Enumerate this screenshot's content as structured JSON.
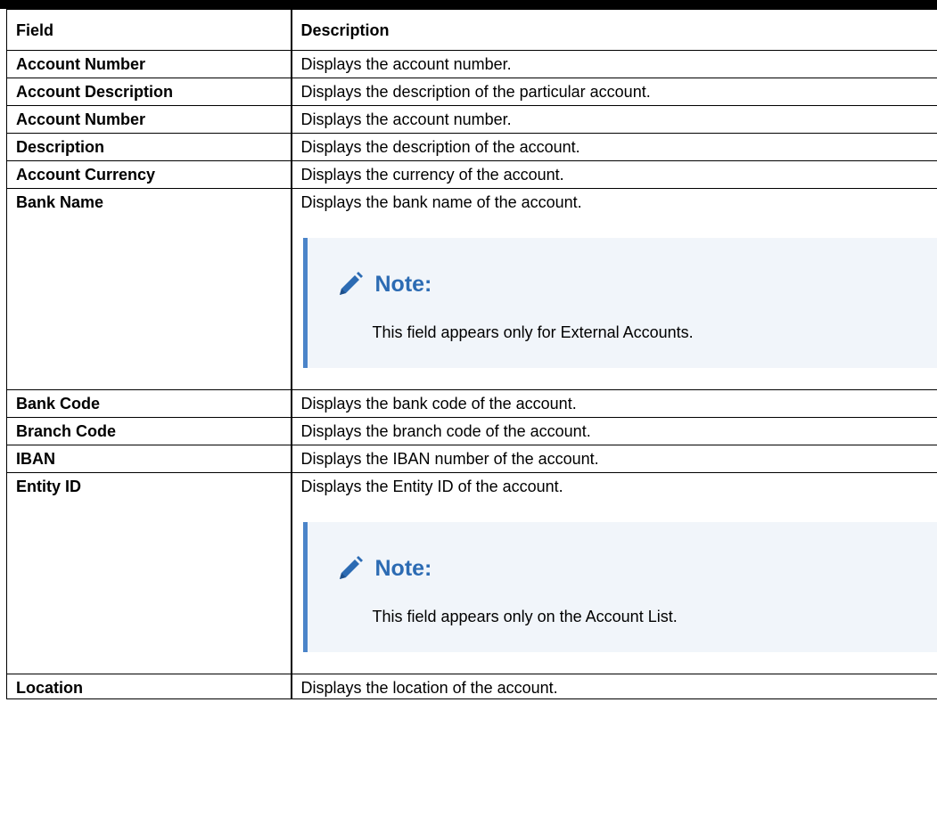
{
  "table": {
    "headers": {
      "field": "Field",
      "description": "Description"
    },
    "rows": [
      {
        "field": "Account Number",
        "description": "Displays the account number."
      },
      {
        "field": "Account Description",
        "description": "Displays the description of the particular account."
      },
      {
        "field": "Account Number",
        "description": "Displays the account number."
      },
      {
        "field": "Description",
        "description": "Displays the description of the account."
      },
      {
        "field": "Account Currency",
        "description": "Displays the currency of the account."
      },
      {
        "field": "Bank Name",
        "description": "Displays the bank name of the account.",
        "note_title": "Note:",
        "note_text": "This field appears only for External Accounts."
      },
      {
        "field": "Bank Code",
        "description": "Displays the bank code of the account."
      },
      {
        "field": "Branch Code",
        "description": "Displays the branch code of the account."
      },
      {
        "field": "IBAN",
        "description": "Displays the IBAN number of the account."
      },
      {
        "field": "Entity ID",
        "description": "Displays the Entity ID of the account.",
        "note_title": "Note:",
        "note_text": "This field appears only on the Account List."
      },
      {
        "field": "Location",
        "description": "Displays the location of the account."
      }
    ]
  },
  "note_icon": "pencil-icon",
  "colors": {
    "note_background": "#f1f5fa",
    "note_accent": "#4b84c9",
    "note_title": "#2c6bb3"
  }
}
